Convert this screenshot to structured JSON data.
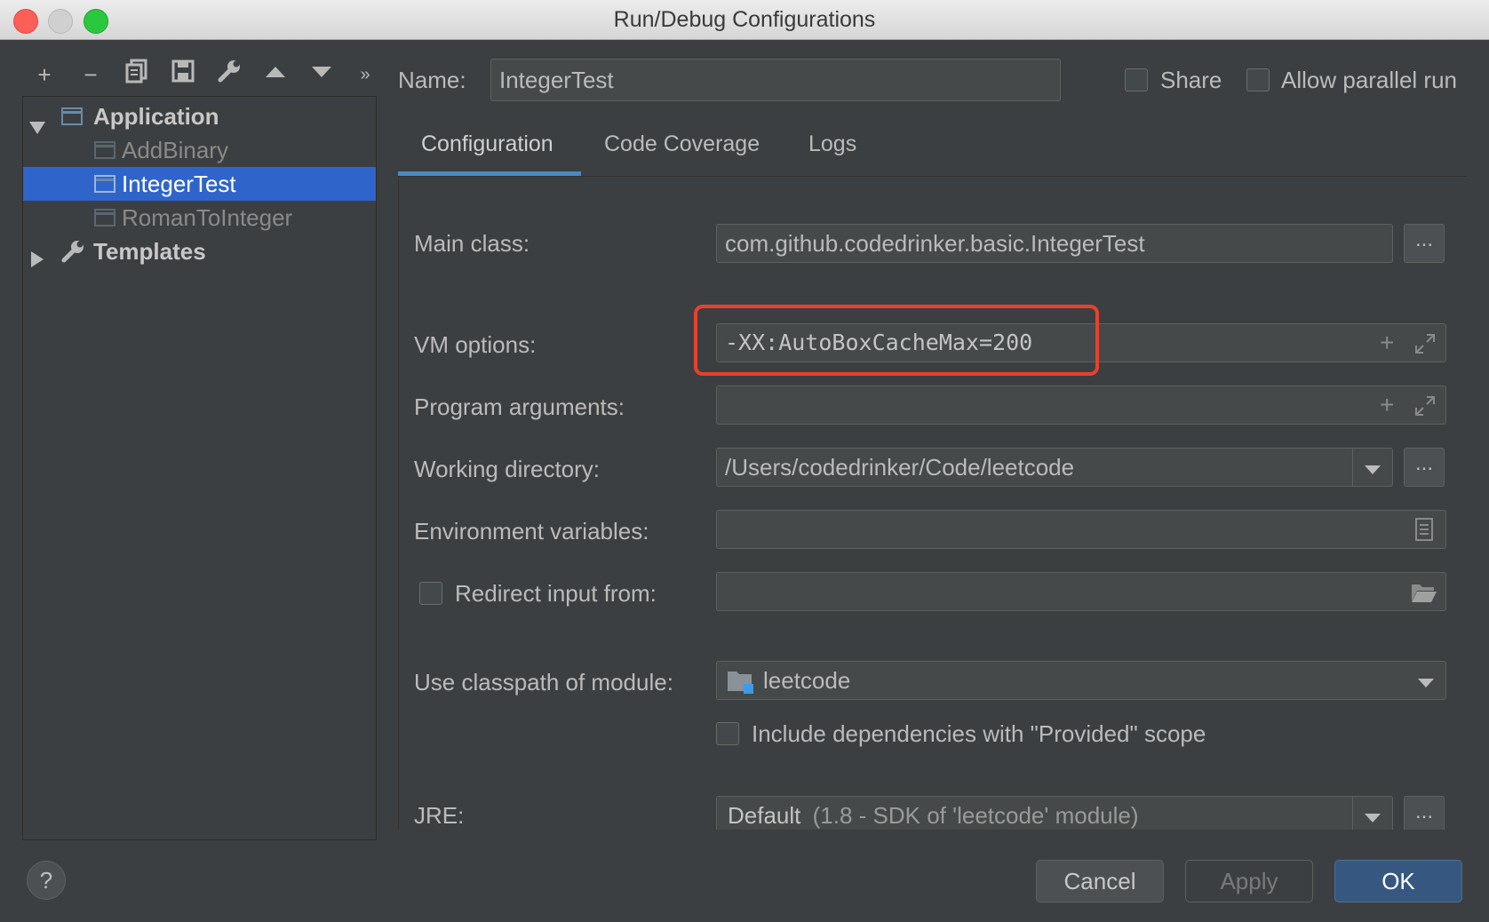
{
  "window": {
    "title": "Run/Debug Configurations"
  },
  "toolbar": {
    "add": "+",
    "remove": "−",
    "copy": "⧉",
    "save": "▣",
    "edit": "🔧",
    "up": "▲",
    "down": "▼",
    "more": "»"
  },
  "tree": {
    "application_label": "Application",
    "items": [
      "AddBinary",
      "IntegerTest",
      "RomanToInteger"
    ],
    "templates_label": "Templates"
  },
  "header": {
    "name_label": "Name:",
    "name_value": "IntegerTest",
    "share_label": "Share",
    "parallel_label": "Allow parallel run"
  },
  "tabs": [
    "Configuration",
    "Code Coverage",
    "Logs"
  ],
  "form": {
    "main_class_label": "Main class:",
    "main_class_value": "com.github.codedrinker.basic.IntegerTest",
    "vm_options_label": "VM options:",
    "vm_options_value": "-XX:AutoBoxCacheMax=200",
    "program_args_label": "Program arguments:",
    "program_args_value": "",
    "working_dir_label": "Working directory:",
    "working_dir_value": "/Users/codedrinker/Code/leetcode",
    "env_vars_label": "Environment variables:",
    "env_vars_value": "",
    "redirect_label": "Redirect input from:",
    "redirect_value": "",
    "classpath_label": "Use classpath of module:",
    "classpath_value": "leetcode",
    "include_deps_label": "Include dependencies with \"Provided\" scope",
    "jre_label": "JRE:",
    "jre_value": "Default",
    "jre_detail": "(1.8 - SDK of 'leetcode' module)",
    "browse": "..."
  },
  "footer": {
    "help": "?",
    "cancel": "Cancel",
    "apply": "Apply",
    "ok": "OK"
  },
  "colors": {
    "selection": "#2f65ca",
    "highlight_box": "#e8412c",
    "ok_button": "#365880",
    "tab_underline": "#4a88c7"
  }
}
